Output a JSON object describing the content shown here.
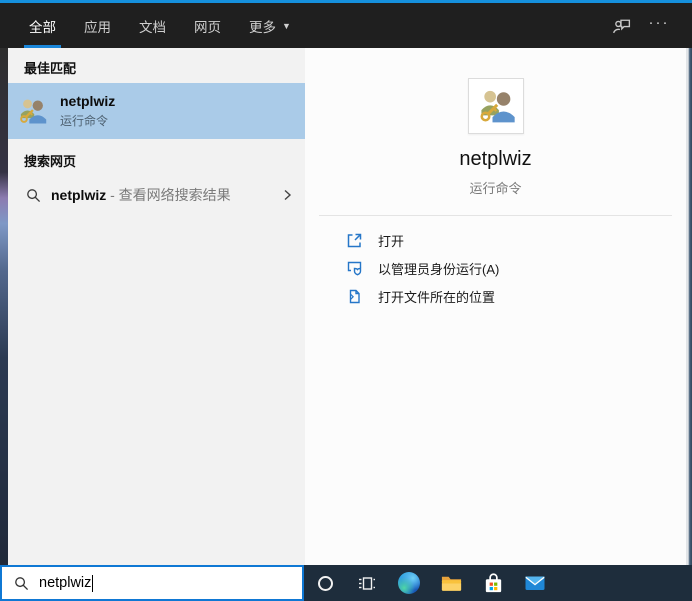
{
  "header": {
    "tabs": [
      {
        "label": "全部",
        "selected": true
      },
      {
        "label": "应用"
      },
      {
        "label": "文档"
      },
      {
        "label": "网页"
      },
      {
        "label": "更多",
        "dropdown": "▼"
      }
    ],
    "more_options": "···"
  },
  "left_panel": {
    "best_match": {
      "section_title": "最佳匹配",
      "item": {
        "title": "netplwiz",
        "subtitle": "运行命令",
        "icon": "user-accounts-icon"
      }
    },
    "web_search": {
      "section_title": "搜索网页",
      "item": {
        "query": "netplwiz",
        "suffix": " - 查看网络搜索结果",
        "icon": "search-icon"
      }
    }
  },
  "right_panel": {
    "title": "netplwiz",
    "subtitle": "运行命令",
    "icon": "user-accounts-icon",
    "actions": [
      {
        "label": "打开",
        "icon": "open-icon"
      },
      {
        "label": "以管理员身份运行(A)",
        "icon": "run-as-admin-icon"
      },
      {
        "label": "打开文件所在的位置",
        "icon": "open-file-location-icon"
      }
    ]
  },
  "search_bar": {
    "value": "netplwiz",
    "icon": "search-icon"
  },
  "taskbar": {
    "icons": [
      "cortana-icon",
      "task-view-icon",
      "edge-icon",
      "file-explorer-icon",
      "store-icon",
      "mail-icon"
    ]
  },
  "colors": {
    "accent_blue": "#1a86d9",
    "selection_blue": "#aacbe8",
    "search_border_blue": "#0f78d4",
    "action_icon_blue": "#2576c8",
    "taskbar_bg": "#1e2d3c",
    "header_bg": "#1f1f1f",
    "left_panel_bg": "#f2f2f2",
    "right_panel_bg": "#fcfcfc"
  }
}
